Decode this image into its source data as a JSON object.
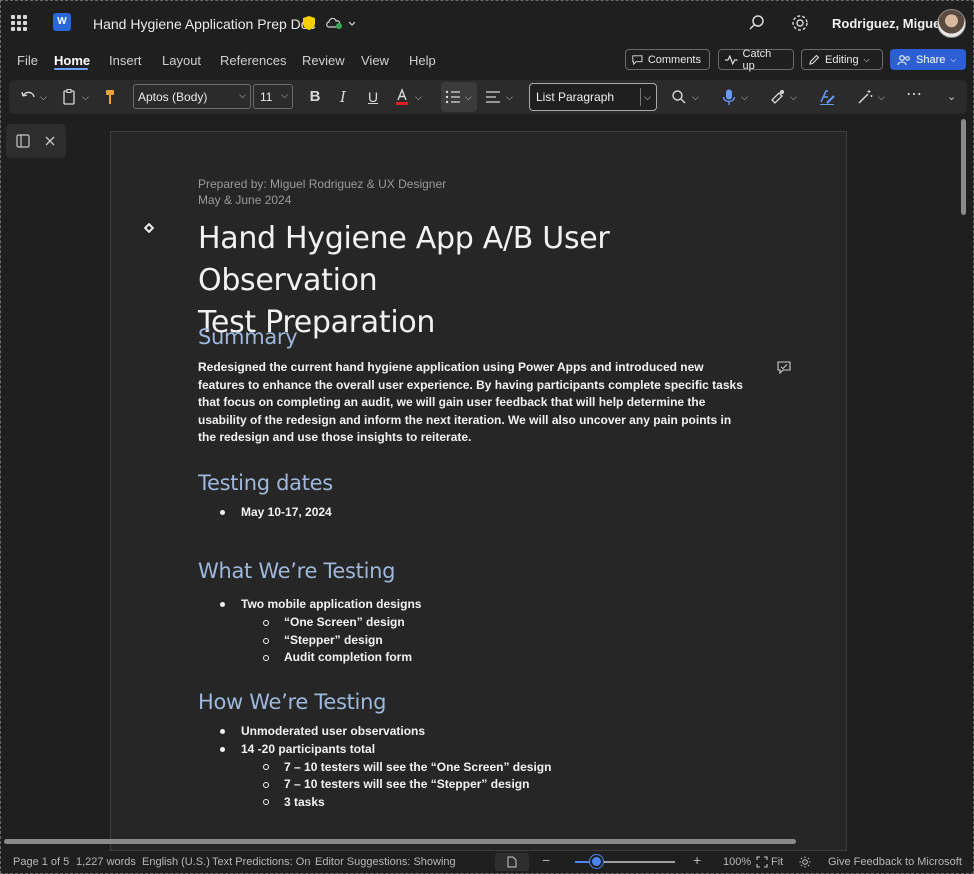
{
  "app": {
    "doc_title": "Hand Hygiene Application Prep Doc",
    "user_name": "Rodriguez, Miguel",
    "logo_letter": "W"
  },
  "menu": {
    "tabs": [
      "File",
      "Home",
      "Insert",
      "Layout",
      "References",
      "Review",
      "View",
      "Help"
    ],
    "active_tab": "Home",
    "comments_label": "Comments",
    "catchup_label": "Catch up",
    "editing_label": "Editing",
    "share_label": "Share"
  },
  "ribbon": {
    "font_name": "Aptos (Body)",
    "font_size": "11",
    "style": "List Paragraph",
    "font_color": "#e02020"
  },
  "document": {
    "prepared_by": "Prepared by: Miguel Rodriguez & UX Designer",
    "dates": "May & June 2024",
    "title_line1": "Hand Hygiene App A/B User Observation",
    "title_line2": "Test Preparation",
    "summary_heading": "Summary",
    "summary_text": "Redesigned the current hand hygiene application using Power Apps and introduced new features to enhance the overall user experience. By having participants complete specific tasks that focus on completing an audit, we will gain user feedback that will help determine the usability of the redesign and inform the next iteration. We will also uncover any pain points in the redesign and use those insights to reiterate.",
    "testing_dates_heading": "Testing dates",
    "testing_dates_items": [
      "May 10-17, 2024"
    ],
    "what_heading": "What We’re Testing",
    "what_item": "Two mobile application designs",
    "what_subitems": [
      "“One Screen” design",
      "“Stepper” design",
      "Audit completion form"
    ],
    "how_heading": "How We’re Testing",
    "how_items": [
      "Unmoderated user observations",
      "14 -20  participants total"
    ],
    "how_subitems": [
      "7 – 10 testers will see the “One Screen” design",
      "7 – 10 testers will see the “Stepper” design",
      "3 tasks"
    ]
  },
  "status": {
    "page": "Page 1 of 5",
    "words": "1,227 words",
    "language": "English (U.S.)",
    "text_predictions": "Text Predictions: On",
    "editor_suggestions": "Editor Suggestions: Showing",
    "zoom": "100%",
    "fit": "Fit",
    "feedback": "Give Feedback to Microsoft",
    "zoom_fraction": 0.22
  },
  "colors": {
    "accent": "#2d5fd4",
    "heading": "#9db8dc",
    "background": "#1f1f1f"
  }
}
